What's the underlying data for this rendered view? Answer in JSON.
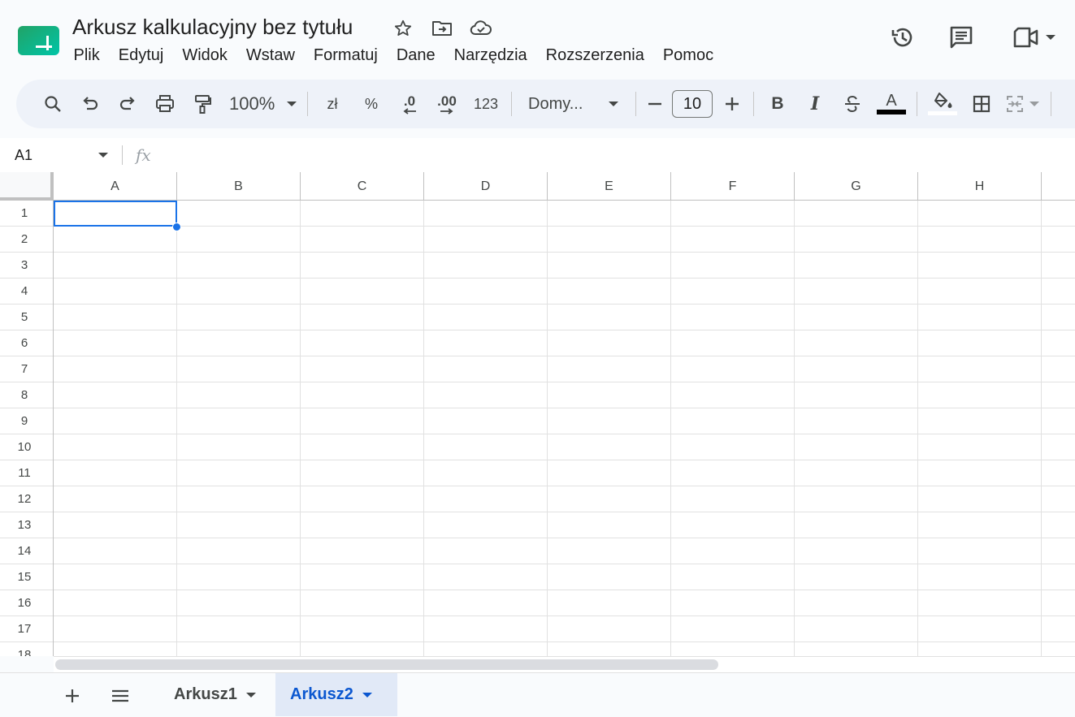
{
  "doc": {
    "title": "Arkusz kalkulacyjny bez tytułu"
  },
  "menu": [
    "Plik",
    "Edytuj",
    "Widok",
    "Wstaw",
    "Formatuj",
    "Dane",
    "Narzędzia",
    "Rozszerzenia",
    "Pomoc"
  ],
  "toolbar": {
    "zoom": "100%",
    "currency": "zł",
    "percent": "%",
    "dec_decrease": ".0",
    "dec_increase": ".00",
    "format_more": "123",
    "font": "Domy...",
    "font_size": "10",
    "bold": "B",
    "italic": "I",
    "text_color_letter": "A"
  },
  "formula": {
    "cell_ref": "A1",
    "fx": "fx",
    "value": ""
  },
  "grid": {
    "columns": [
      "A",
      "B",
      "C",
      "D",
      "E",
      "F",
      "G",
      "H"
    ],
    "rows": [
      "1",
      "2",
      "3",
      "4",
      "5",
      "6",
      "7",
      "8",
      "9",
      "10",
      "11",
      "12",
      "13",
      "14",
      "15",
      "16",
      "17",
      "18"
    ],
    "selected_cell": "A1"
  },
  "sheets": [
    {
      "name": "Arkusz1",
      "active": false
    },
    {
      "name": "Arkusz2",
      "active": true
    }
  ],
  "colors": {
    "accent": "#1a73e8",
    "active_tab_bg": "#e1e9f7",
    "active_tab_text": "#0b57d0",
    "logo_green": "#1fa463"
  }
}
